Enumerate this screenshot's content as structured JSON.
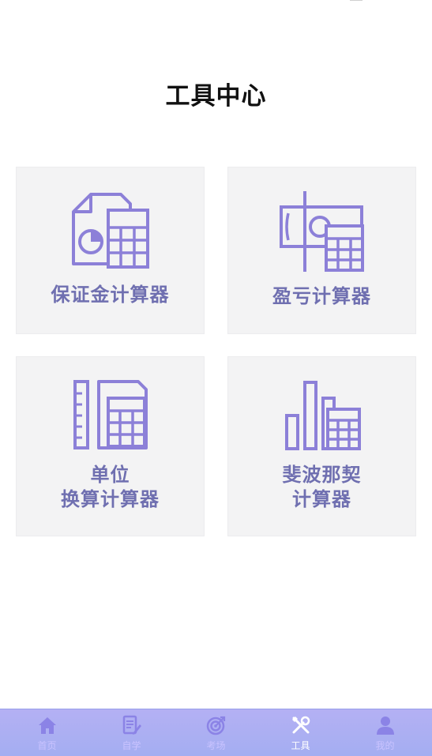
{
  "page": {
    "title": "工具中心"
  },
  "tools": [
    {
      "lines": [
        "保证金计算器"
      ],
      "icon": "document-pie-calculator-icon"
    },
    {
      "lines": [
        "盈亏计算器"
      ],
      "icon": "banknote-calculator-icon"
    },
    {
      "lines": [
        "单位",
        "换算计算器"
      ],
      "icon": "ruler-calculator-icon"
    },
    {
      "lines": [
        "斐波那契",
        "计算器"
      ],
      "icon": "bar-chart-calculator-icon"
    }
  ],
  "tabbar": {
    "items": [
      {
        "label": "首页",
        "icon": "home-icon",
        "active": false
      },
      {
        "label": "自学",
        "icon": "study-notes-icon",
        "active": false
      },
      {
        "label": "考场",
        "icon": "target-icon",
        "active": false
      },
      {
        "label": "工具",
        "icon": "tools-icon",
        "active": true
      },
      {
        "label": "我的",
        "icon": "user-icon",
        "active": false
      }
    ]
  },
  "colors": {
    "accent": "#8c80d8",
    "label": "#6f6fb0",
    "card_bg": "#f3f3f4",
    "tabbar_top": "#b4b0f4",
    "tabbar_bottom": "#a4aef1"
  }
}
